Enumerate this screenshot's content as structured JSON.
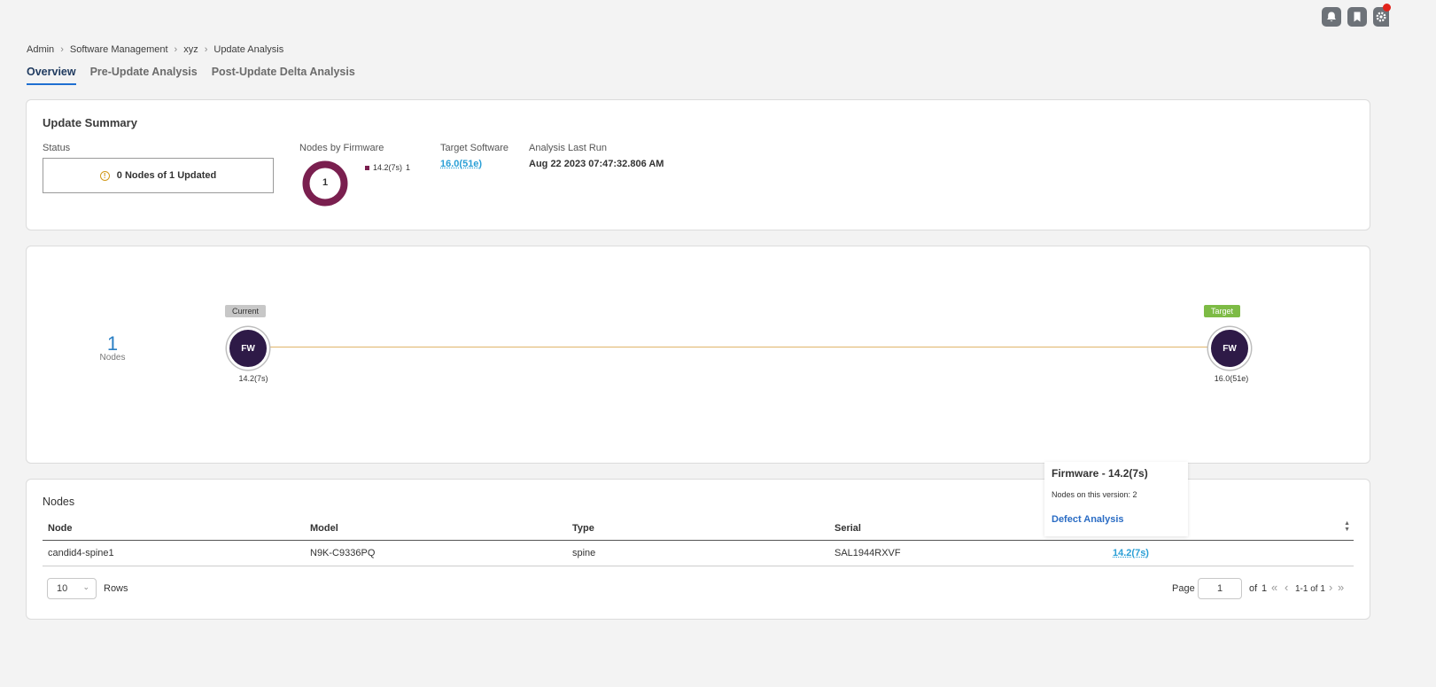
{
  "header": {
    "icons": [
      "bell-icon",
      "bookmark-icon",
      "gear-icon"
    ]
  },
  "breadcrumb": {
    "items": [
      "Admin",
      "Software Management",
      "xyz",
      "Update Analysis"
    ]
  },
  "tabs": [
    {
      "label": "Overview",
      "active": true
    },
    {
      "label": "Pre-Update Analysis",
      "active": false
    },
    {
      "label": "Post-Update Delta Analysis",
      "active": false
    }
  ],
  "summary": {
    "title": "Update Summary",
    "status_label": "Status",
    "status_text": "0 Nodes of 1 Updated",
    "nodes_by_fw_label": "Nodes by Firmware",
    "donut_center": "1",
    "donut_legend": {
      "version": "14.2(7s)",
      "count": "1",
      "color": "#7a1f4f"
    },
    "target_label": "Target Software",
    "target_value": "16.0(51e)",
    "last_run_label": "Analysis Last Run",
    "last_run_value": "Aug 22 2023 07:47:32.806 AM"
  },
  "flow": {
    "node_count": "1",
    "node_count_label": "Nodes",
    "current_pill": "Current",
    "target_pill": "Target",
    "current_node_text": "FW",
    "target_node_text": "FW",
    "current_version": "14.2(7s)",
    "target_version": "16.0(51e)",
    "line_color": "#e0b46a"
  },
  "nodes_table": {
    "title": "Nodes",
    "columns": [
      "Node",
      "Model",
      "Type",
      "Serial",
      ""
    ],
    "rows": [
      {
        "node": "candid4-spine1",
        "model": "N9K-C9336PQ",
        "type": "spine",
        "serial": "SAL1944RXVF",
        "firmware": "14.2(7s)"
      }
    ],
    "rows_per_page": "10",
    "rows_label": "Rows",
    "page_label": "Page",
    "page_value": "1",
    "of_label": "of",
    "total_pages": "1",
    "range_label": "1-1 of 1"
  },
  "popover": {
    "title": "Firmware - 14.2(7s)",
    "subtitle": "Nodes on this version: 2",
    "link": "Defect Analysis"
  }
}
